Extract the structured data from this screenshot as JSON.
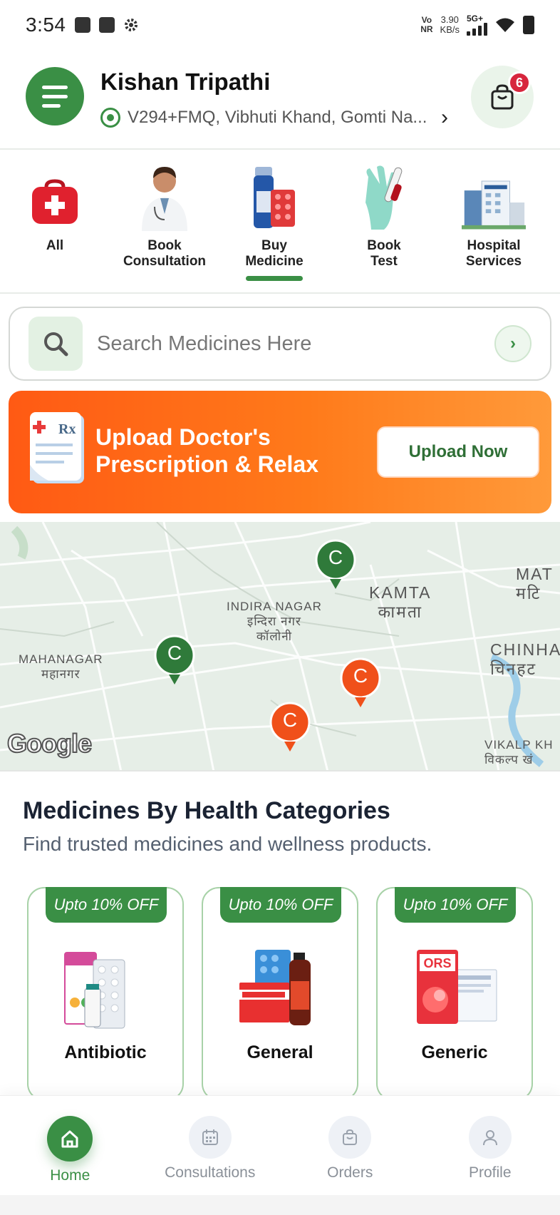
{
  "status_bar": {
    "time": "3:54",
    "network_type": "Vo\nNR",
    "speed_value": "3.90",
    "speed_unit": "KB/s",
    "signal": "5G+"
  },
  "header": {
    "user_name": "Kishan Tripathi",
    "location": "V294+FMQ, Vibhuti Khand, Gomti Na...",
    "cart_count": "6"
  },
  "categories": [
    {
      "label_line1": "All",
      "label_line2": ""
    },
    {
      "label_line1": "Book",
      "label_line2": "Consultation"
    },
    {
      "label_line1": "Buy",
      "label_line2": "Medicine"
    },
    {
      "label_line1": "Book",
      "label_line2": "Test"
    },
    {
      "label_line1": "Hospital",
      "label_line2": "Services"
    }
  ],
  "active_category": "Buy Medicine",
  "search": {
    "placeholder": "Search Medicines Here"
  },
  "banner": {
    "line1": "Upload Doctor's",
    "line2": "Prescription & Relax",
    "button": "Upload Now",
    "colors": {
      "start": "#ff5a14",
      "end": "#ff9a3a"
    }
  },
  "map": {
    "labels": {
      "indira_nagar": "INDIRA NAGAR",
      "indira_nagar_hi_1": "इन्दिरा नगर",
      "indira_nagar_hi_2": "कॉलोनी",
      "kamta": "KAMTA",
      "kamta_hi": "कामता",
      "mahanagar": "MAHANAGAR",
      "mahanagar_hi": "महानगर",
      "mat": "MAT",
      "mat_hi": "मटि",
      "chinhat": "CHINHA",
      "chinhat_hi": "चिनहट",
      "vikalp": "VIKALP KH",
      "vikalp_hi": "विकल्प खं"
    },
    "pin_letter": "C",
    "attribution": "Google"
  },
  "section": {
    "title": "Medicines By Health Categories",
    "subtitle": "Find trusted medicines and wellness products."
  },
  "products": [
    {
      "badge": "Upto 10% OFF",
      "name": "Antibiotic"
    },
    {
      "badge": "Upto 10% OFF",
      "name": "General"
    },
    {
      "badge": "Upto 10% OFF",
      "name": "Generic"
    }
  ],
  "bottom_nav": [
    {
      "label": "Home",
      "icon": "home-icon",
      "active": true
    },
    {
      "label": "Consultations",
      "icon": "calendar-icon",
      "active": false
    },
    {
      "label": "Orders",
      "icon": "bag-icon",
      "active": false
    },
    {
      "label": "Profile",
      "icon": "person-icon",
      "active": false
    }
  ],
  "colors": {
    "brand_green": "#3a8f45",
    "accent_orange": "#ff5a14",
    "badge_red": "#d7263d"
  }
}
